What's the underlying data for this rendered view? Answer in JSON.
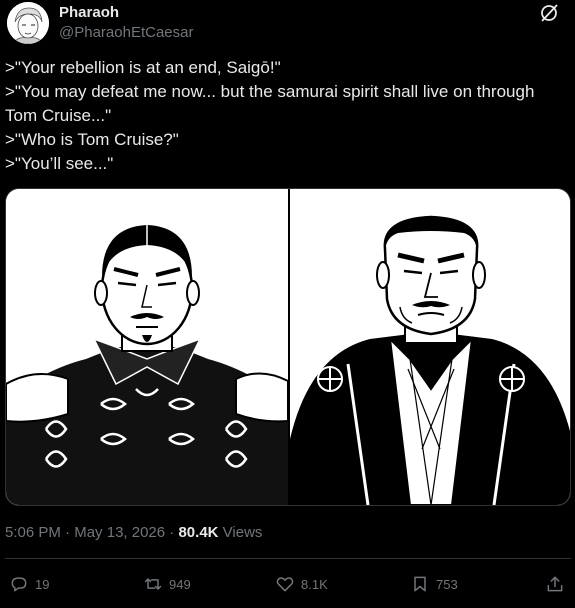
{
  "author": {
    "name": "Pharaoh",
    "handle": "@PharaohEtCaesar"
  },
  "tweet": {
    "lines": [
      ">\"Your rebellion is at an end, Saigō!\"",
      ">\"You may defeat me now... but the samurai spirit shall live on through Tom Cruise...\"",
      ">\"Who is Tom Cruise?\"",
      ">\"You’ll see...\""
    ]
  },
  "meta": {
    "time": "5:06 PM",
    "separator": "·",
    "date": "May 13, 2026",
    "views_count": "80.4K",
    "views_label": "Views"
  },
  "actions": {
    "replies": "19",
    "retweets": "949",
    "likes": "8.1K",
    "bookmarks": "753"
  },
  "icons": {
    "header": "grok-slash-icon",
    "reply": "reply-icon",
    "retweet": "retweet-icon",
    "like": "heart-icon",
    "bookmark": "bookmark-icon",
    "share": "share-icon"
  },
  "colors": {
    "background": "#000000",
    "text": "#e7e9ea",
    "muted": "#71767b",
    "border": "#2f3336"
  }
}
